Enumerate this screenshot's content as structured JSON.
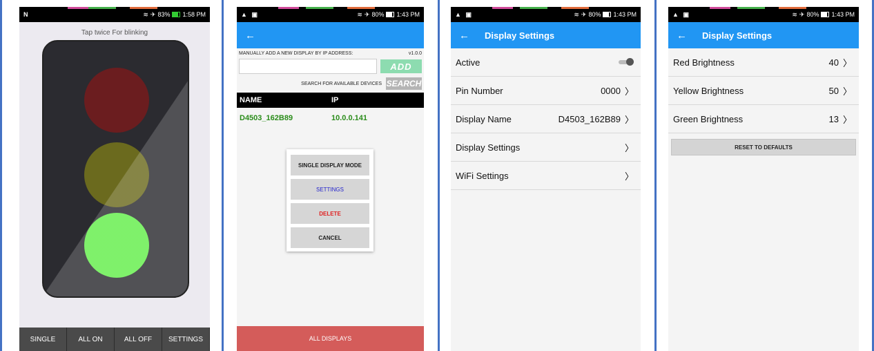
{
  "colors": {
    "frame_blue": "#4472c4",
    "appbar_blue": "#2196f3",
    "lamp_red": "#6b1d1f",
    "lamp_yellow": "#6b6a1e",
    "lamp_green": "#63ee4a",
    "add_green": "#8ddcb0",
    "row_green": "#2a8c1a",
    "all_displays_red": "#d45c5a"
  },
  "screen1": {
    "status": {
      "left_icon": "n-icon",
      "battery": "83%",
      "time": "1:58 PM"
    },
    "tap_note": "Tap twice For blinking",
    "lights": {
      "red": "off",
      "yellow": "off",
      "green": "on"
    },
    "bottom_buttons": [
      "SINGLE",
      "ALL ON",
      "ALL OFF",
      "SETTINGS"
    ]
  },
  "screen2": {
    "status": {
      "battery": "80%",
      "time": "1:43 PM"
    },
    "manual_label": "MANUALLY ADD A NEW DISPLAY BY IP ADDRESS:",
    "version": "v1.0.0",
    "ip_value": "",
    "add_label": "ADD",
    "search_label": "SEARCH FOR AVAILABLE DEVICES",
    "search_button": "SEARCH",
    "table_headers": [
      "NAME",
      "IP"
    ],
    "rows": [
      {
        "name": "D4503_162B89",
        "ip": "10.0.0.141"
      }
    ],
    "dialog": {
      "single_mode": "SINGLE DISPLAY MODE",
      "settings": "SETTINGS",
      "delete": "DELETE",
      "cancel": "CANCEL"
    },
    "all_displays": "ALL DISPLAYS"
  },
  "screen3": {
    "status": {
      "battery": "80%",
      "time": "1:43 PM"
    },
    "title": "Display Settings",
    "rows": [
      {
        "label": "Active",
        "value": ""
      },
      {
        "label": "Pin Number",
        "value": "0000"
      },
      {
        "label": "Display Name",
        "value": "D4503_162B89"
      },
      {
        "label": "Display Settings",
        "value": ""
      },
      {
        "label": "WiFi Settings",
        "value": ""
      }
    ],
    "active_toggle": "on"
  },
  "screen4": {
    "status": {
      "battery": "80%",
      "time": "1:43 PM"
    },
    "title": "Display Settings",
    "rows": [
      {
        "label": "Red Brightness",
        "value": "40"
      },
      {
        "label": "Yellow Brightness",
        "value": "50"
      },
      {
        "label": "Green Brightness",
        "value": "13"
      }
    ],
    "reset_label": "RESET TO DEFAULTS"
  }
}
